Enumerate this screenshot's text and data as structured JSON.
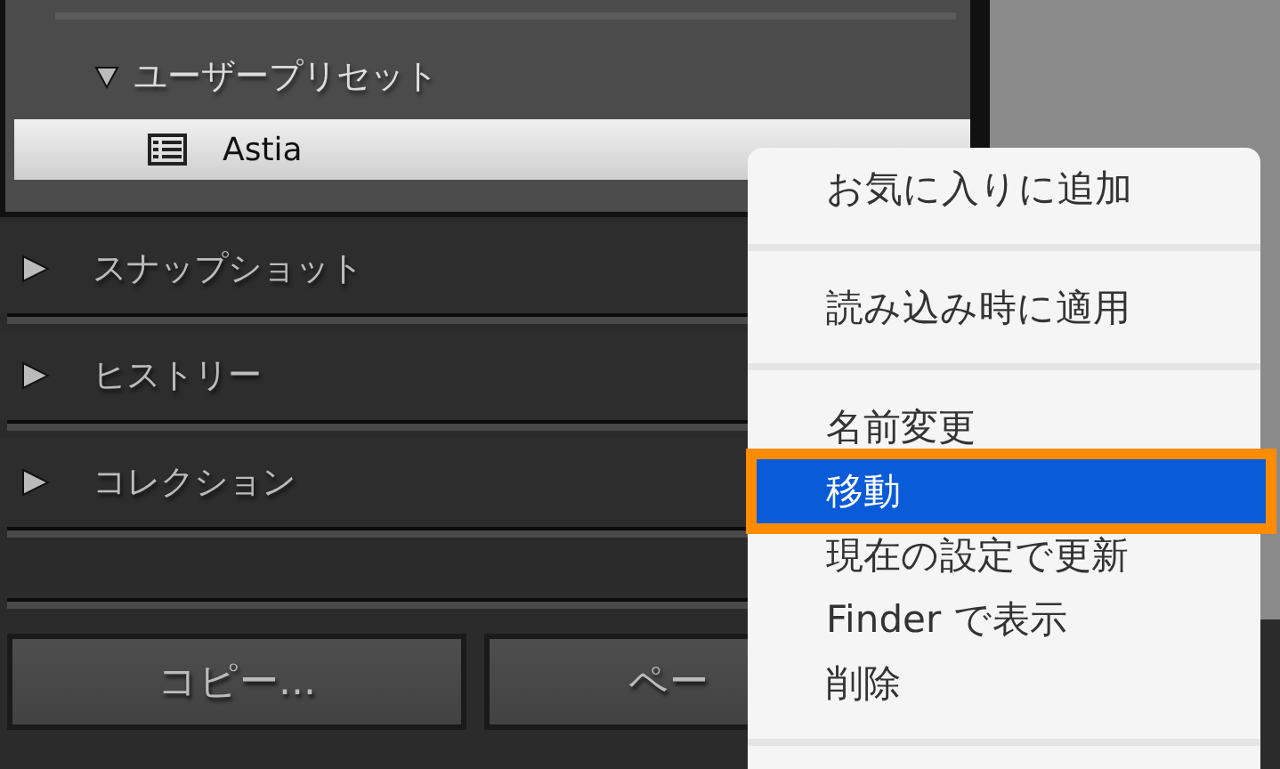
{
  "presets": {
    "group": {
      "label": "ユーザープリセット",
      "expanded": true,
      "items": [
        {
          "label": "Astia",
          "selected": true
        }
      ]
    }
  },
  "sections": [
    {
      "label": "スナップショット",
      "expanded": false
    },
    {
      "label": "ヒストリー",
      "expanded": false
    },
    {
      "label": "コレクション",
      "expanded": false
    }
  ],
  "buttons": [
    "コピー...",
    "ペー"
  ],
  "context_menu": {
    "groups": [
      [
        {
          "label": "お気に入りに追加",
          "selected": false
        }
      ],
      [
        {
          "label": "読み込み時に適用",
          "selected": false
        }
      ],
      [
        {
          "label": "名前変更",
          "selected": false
        },
        {
          "label": "移動",
          "selected": true
        },
        {
          "label": "現在の設定で更新",
          "selected": false
        },
        {
          "label": "Finder で表示",
          "selected": false
        },
        {
          "label": "削除",
          "selected": false
        }
      ]
    ]
  }
}
